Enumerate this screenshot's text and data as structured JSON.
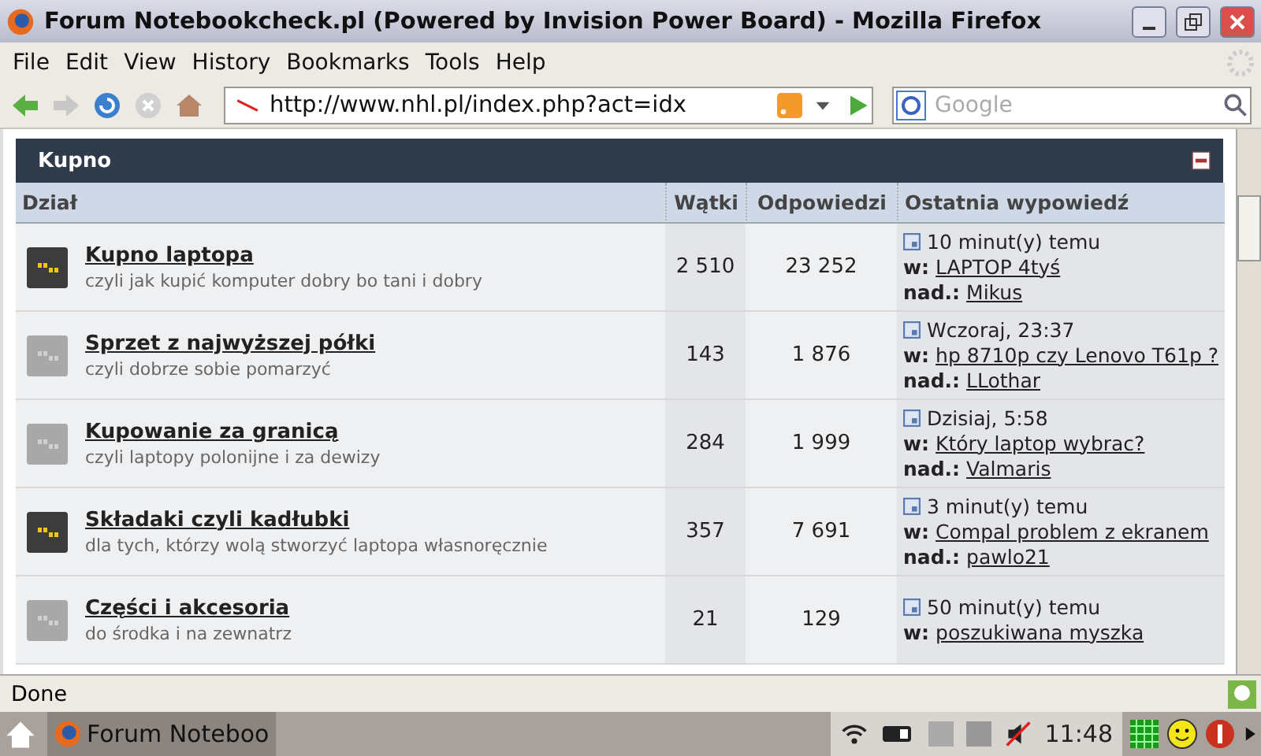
{
  "window": {
    "title": "Forum Notebookcheck.pl (Powered by Invision Power Board) - Mozilla Firefox"
  },
  "menu": [
    "File",
    "Edit",
    "View",
    "History",
    "Bookmarks",
    "Tools",
    "Help"
  ],
  "navbar": {
    "url": "http://www.nhl.pl/index.php?act=idx",
    "search_placeholder": "Google"
  },
  "forum": {
    "title": "Kupno",
    "columns": [
      "Dział",
      "Wątki",
      "Odpowiedzi",
      "Ostatnia wypowiedź"
    ],
    "rows": [
      {
        "name": "Kupno laptopa",
        "description": "czyli jak kupić komputer dobry bo tani i dobry",
        "unread": true,
        "topics": "2 510",
        "replies": "23 252",
        "last_post": {
          "time": "10 minut(y) temu",
          "in_label": "w:",
          "topic": "LAPTOP 4tyś",
          "by_label": "nad.:",
          "author": "Mikus"
        }
      },
      {
        "name": "Sprzet z najwyższej półki",
        "description": "czyli dobrze sobie pomarzyć",
        "unread": false,
        "topics": "143",
        "replies": "1 876",
        "last_post": {
          "time": "Wczoraj, 23:37",
          "in_label": "w:",
          "topic": "hp 8710p czy Lenovo T61p ?",
          "by_label": "nad.:",
          "author": "LLothar"
        }
      },
      {
        "name": "Kupowanie za granicą",
        "description": "czyli laptopy polonijne i za dewizy",
        "unread": false,
        "topics": "284",
        "replies": "1 999",
        "last_post": {
          "time": "Dzisiaj, 5:58",
          "in_label": "w:",
          "topic": "Który laptop wybrac?",
          "by_label": "nad.:",
          "author": "Valmaris"
        }
      },
      {
        "name": "Składaki czyli kadłubki",
        "description": "dla tych, którzy wolą stworzyć laptopa własnoręcznie",
        "unread": true,
        "topics": "357",
        "replies": "7 691",
        "last_post": {
          "time": "3 minut(y) temu",
          "in_label": "w:",
          "topic": "Compal problem z ekranem",
          "by_label": "nad.:",
          "author": "pawlo21"
        }
      },
      {
        "name": "Części i akcesoria",
        "description": "do środka i na zewnatrz",
        "unread": false,
        "topics": "21",
        "replies": "129",
        "last_post": {
          "time": "50 minut(y) temu",
          "in_label": "w:",
          "topic": "poszukiwana myszka"
        }
      }
    ]
  },
  "status_bar": {
    "text": "Done"
  },
  "taskbar": {
    "task": "Forum Noteboo",
    "clock": "11:48"
  }
}
